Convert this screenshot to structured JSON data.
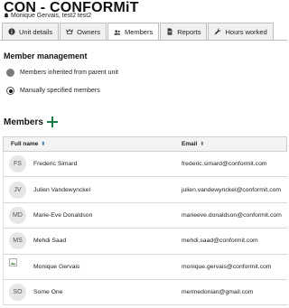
{
  "header": {
    "title": "CON - CONFORMiT",
    "subtitle": "Monique Gervais, test2 test2",
    "subtitle_icon": "bell-icon"
  },
  "tabs": [
    {
      "label": "Unit details",
      "icon": "info-circle-icon",
      "active": false
    },
    {
      "label": "Owners",
      "icon": "crown-icon",
      "active": false
    },
    {
      "label": "Members",
      "icon": "users-icon",
      "active": true
    },
    {
      "label": "Reports",
      "icon": "document-icon",
      "active": false
    },
    {
      "label": "Hours worked",
      "icon": "wrench-icon",
      "active": false
    }
  ],
  "member_management": {
    "title": "Member management",
    "options": [
      {
        "label": "Members inherited from parent unit",
        "selected": false
      },
      {
        "label": "Manually specified members",
        "selected": true
      }
    ]
  },
  "members": {
    "title": "Members",
    "add_icon": "plus-icon",
    "columns": [
      "Full name",
      "Email"
    ],
    "rows": [
      {
        "initials": "FS",
        "name": "Frederic Simard",
        "email": "frederic.simard@conformit.com"
      },
      {
        "initials": "JV",
        "name": "Julien Vandewynckel",
        "email": "julien.vandewynckel@conformit.com"
      },
      {
        "initials": "MD",
        "name": "Marie-Eve Donaldson",
        "email": "marieeve.donaldson@conformit.com"
      },
      {
        "initials": "MS",
        "name": "Mehdi Saad",
        "email": "mehdi.saad@conformit.com"
      },
      {
        "initials": "",
        "name": "Monique Gervais",
        "email": "monique.gervais@conformit.com"
      },
      {
        "initials": "SO",
        "name": "Some One",
        "email": "mermedonian@gmail.com"
      }
    ]
  },
  "colors": {
    "accent": "#1a7a4a",
    "sort_active": "#2a6ebb"
  }
}
